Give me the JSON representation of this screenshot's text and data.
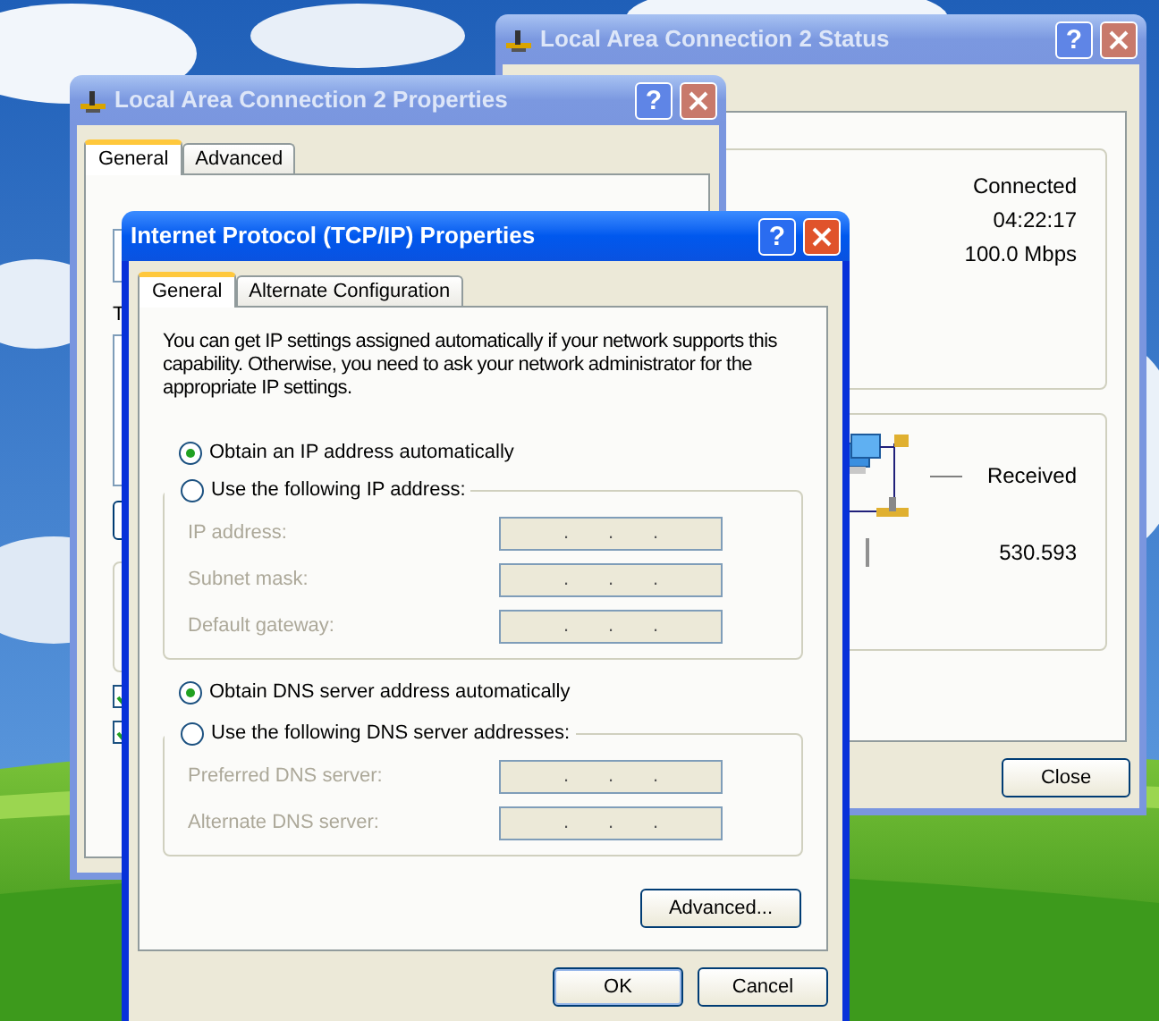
{
  "status_window": {
    "title": "Local Area Connection 2 Status",
    "active": false,
    "help_button": "?",
    "connection_values": [
      "Connected",
      "04:22:17",
      "100.0 Mbps"
    ],
    "activity_label": "Received",
    "received_value": "530.593",
    "close_label": "Close"
  },
  "properties_window": {
    "title": "Local Area Connection 2 Properties",
    "active": false,
    "help_button": "?",
    "tabs": [
      {
        "label": "General",
        "selected": true
      },
      {
        "label": "Advanced",
        "selected": false
      }
    ],
    "cut_label": "T",
    "checkboxes": [
      {
        "checked": true
      },
      {
        "checked": true
      }
    ]
  },
  "tcpip_dialog": {
    "title": "Internet Protocol (TCP/IP) Properties",
    "active": true,
    "help_button": "?",
    "tabs": [
      {
        "label": "General",
        "selected": true
      },
      {
        "label": "Alternate Configuration",
        "selected": false
      }
    ],
    "description": "You can get IP settings assigned automatically if your network supports this capability. Otherwise, you need to ask your network administrator for the appropriate IP settings.",
    "ip_options": [
      {
        "label": "Obtain an IP address automatically",
        "selected": true
      },
      {
        "label": "Use the following IP address:",
        "selected": false
      }
    ],
    "ip_fields": [
      {
        "label": "IP address:",
        "separators": [
          ".",
          ".",
          "."
        ],
        "disabled": true
      },
      {
        "label": "Subnet mask:",
        "separators": [
          ".",
          ".",
          "."
        ],
        "disabled": true
      },
      {
        "label": "Default gateway:",
        "separators": [
          ".",
          ".",
          "."
        ],
        "disabled": true
      }
    ],
    "dns_options": [
      {
        "label": "Obtain DNS server address automatically",
        "selected": true
      },
      {
        "label": "Use the following DNS server addresses:",
        "selected": false
      }
    ],
    "dns_fields": [
      {
        "label": "Preferred DNS server:",
        "separators": [
          ".",
          ".",
          "."
        ],
        "disabled": true
      },
      {
        "label": "Alternate DNS server:",
        "separators": [
          ".",
          ".",
          "."
        ],
        "disabled": true
      }
    ],
    "advanced_button": "Advanced...",
    "buttons": [
      "OK",
      "Cancel"
    ]
  }
}
